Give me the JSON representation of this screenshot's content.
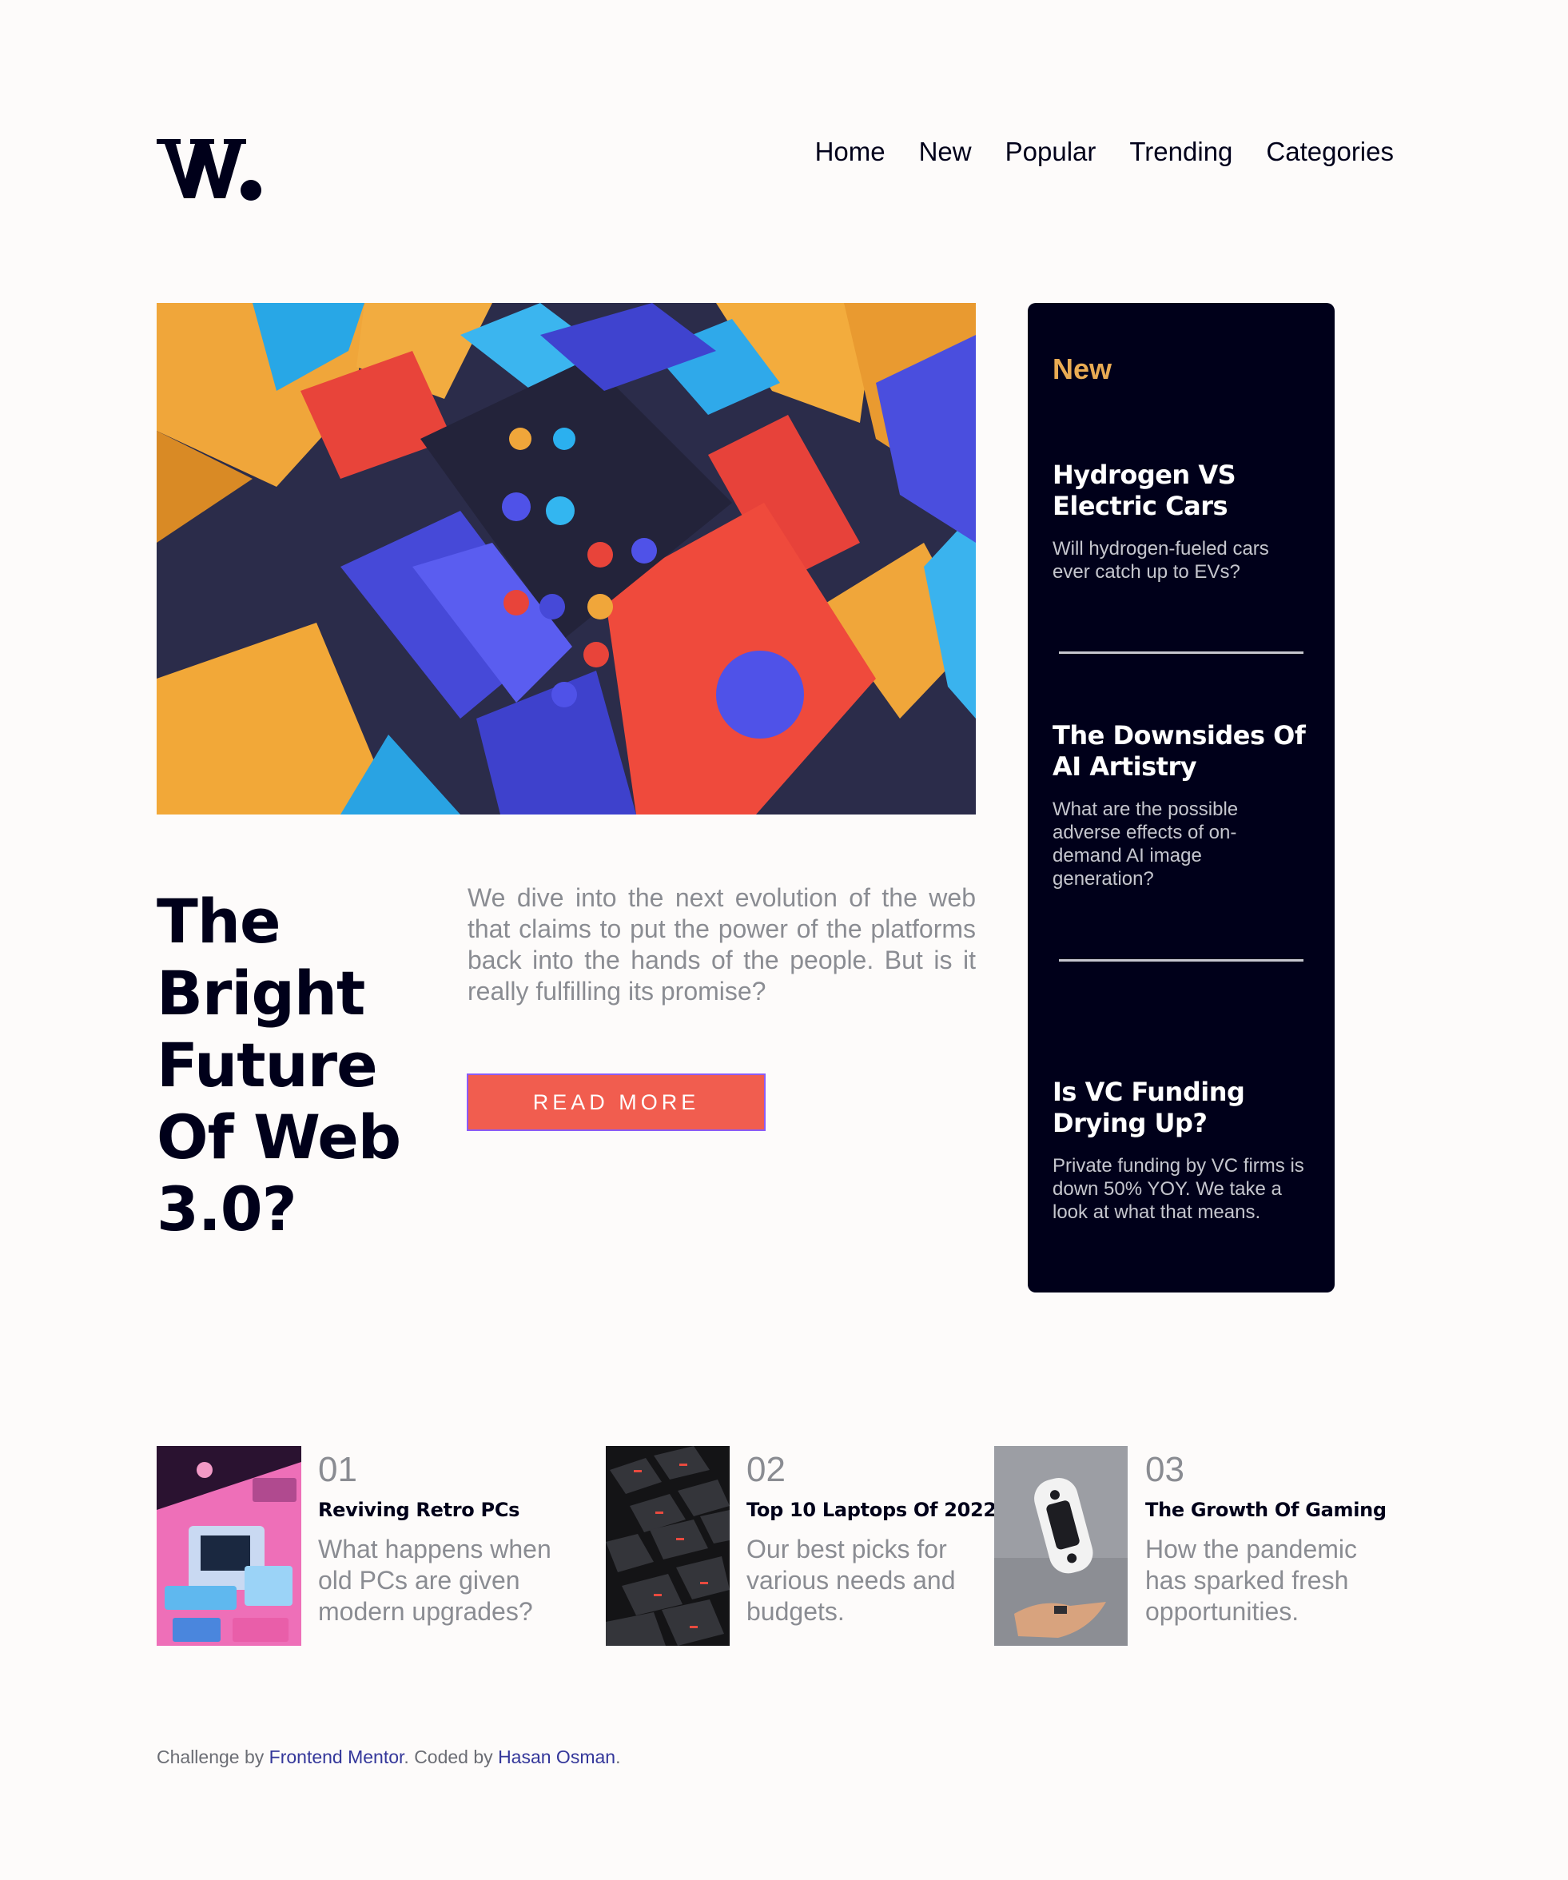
{
  "header": {
    "logo_alt": "W.",
    "nav": [
      "Home",
      "New",
      "Popular",
      "Trending",
      "Categories"
    ]
  },
  "hero": {
    "title": "The Bright Future Of Web 3.0?",
    "description": "We dive into the next evolution of the web that claims to put the power of the platforms back into the hands of the people. But is it really fulfilling its promise?",
    "button": "READ MORE"
  },
  "new_panel": {
    "heading": "New",
    "items": [
      {
        "title": "Hydrogen VS Electric Cars",
        "desc": "Will hydrogen-fueled cars ever catch up to EVs?"
      },
      {
        "title": "The Downsides Of AI Artistry",
        "desc": "What are the possible adverse effects of on-demand AI image generation?"
      },
      {
        "title": "Is VC Funding Drying Up?",
        "desc": "Private funding by VC firms is down 50% YOY. We take a look at what that means."
      }
    ],
    "stray": ";"
  },
  "cards": [
    {
      "num": "01",
      "title": "Reviving Retro PCs",
      "desc": "What happens when old PCs are given modern upgrades?"
    },
    {
      "num": "02",
      "title": "Top 10 Laptops Of 2022",
      "desc": "Our best picks for various needs and budgets."
    },
    {
      "num": "03",
      "title": "The Growth Of Gaming",
      "desc": "How the pandemic has sparked fresh opportunities."
    }
  ],
  "footer": {
    "prefix": "Challenge by",
    "link1": "Frontend Mentor",
    "middle": ". Coded by",
    "link2": "Hasan Osman",
    "suffix": "."
  },
  "colors": {
    "background": "#fdfbfa",
    "dark_navy": "#00001a",
    "accent_red": "#f15d4f",
    "accent_orange": "#e9ab53",
    "grey_text": "#8a8c92",
    "link_blue": "#34379a"
  }
}
